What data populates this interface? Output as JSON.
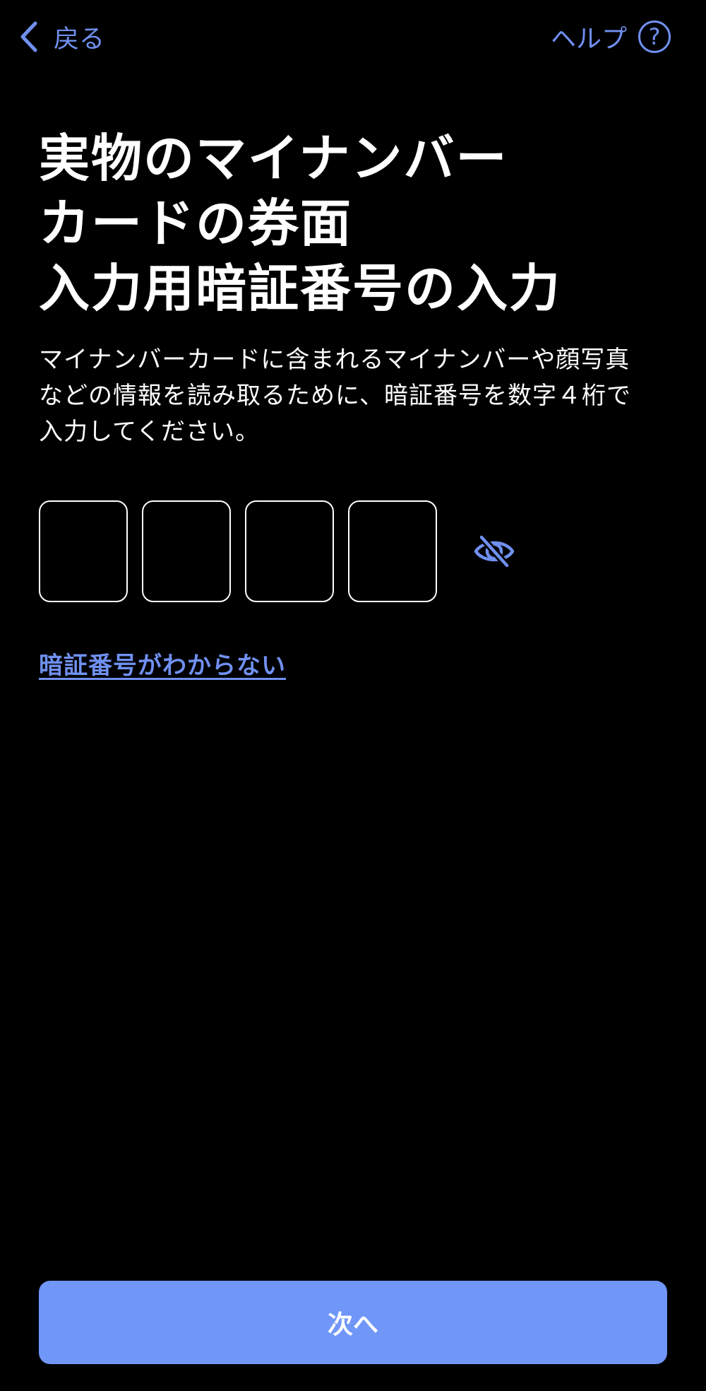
{
  "nav": {
    "back_label": "戻る",
    "help_label": "ヘルプ",
    "help_icon_glyph": "?"
  },
  "title": {
    "lines": [
      "実物のマイナンバー",
      "カードの券面",
      "入力用暗証番号の入力"
    ]
  },
  "description": {
    "lines": [
      "マイナンバーカードに含まれるマイナンバーや顔写真",
      "などの情報を読み取るために、暗証番号を数字４桁で",
      "入力してください。"
    ]
  },
  "pin": {
    "digits": [
      "",
      "",
      "",
      ""
    ],
    "toggle_icon": "eye-slash-icon"
  },
  "forgot_link": "暗証番号がわからない",
  "next_button": "次へ",
  "colors": {
    "background": "#000000",
    "accent": "#7090f0",
    "button": "#7096f8",
    "text": "#ffffff"
  }
}
